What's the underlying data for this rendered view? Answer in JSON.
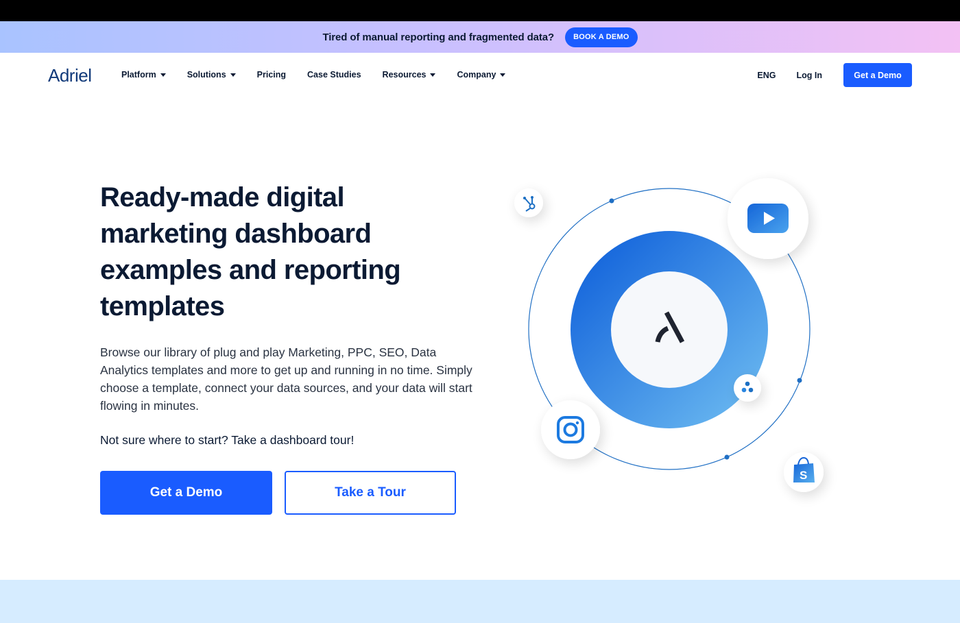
{
  "promo": {
    "text": "Tired of manual reporting and fragmented data?",
    "button_label": "BOOK A DEMO"
  },
  "nav": {
    "logo_text": "Adriel",
    "items": [
      {
        "label": "Platform",
        "has_dropdown": true
      },
      {
        "label": "Solutions",
        "has_dropdown": true
      },
      {
        "label": "Pricing",
        "has_dropdown": false
      },
      {
        "label": "Case Studies",
        "has_dropdown": false
      },
      {
        "label": "Resources",
        "has_dropdown": true
      },
      {
        "label": "Company",
        "has_dropdown": true
      }
    ],
    "language": "ENG",
    "login_label": "Log In",
    "demo_label": "Get a Demo"
  },
  "hero": {
    "title": "Ready-made digital marketing dashboard examples and reporting templates",
    "description": "Browse our library of plug and play Marketing, PPC, SEO, Data Analytics templates and more to get up and running in no time. Simply choose a template, connect your data sources, and your data will start flowing in minutes.",
    "cta_text": "Not sure where to start? Take a dashboard tour!",
    "primary_button": "Get a Demo",
    "secondary_button": "Take a Tour"
  },
  "illustration": {
    "center_logo_icon": "adriel-logo-icon",
    "integrations": [
      "hubspot-icon",
      "youtube-icon",
      "instagram-icon",
      "looker-icon",
      "shopify-icon"
    ]
  },
  "colors": {
    "brand_blue": "#1a5cff",
    "navy_text": "#0b1a33",
    "band_light_blue": "#d6ecff"
  }
}
